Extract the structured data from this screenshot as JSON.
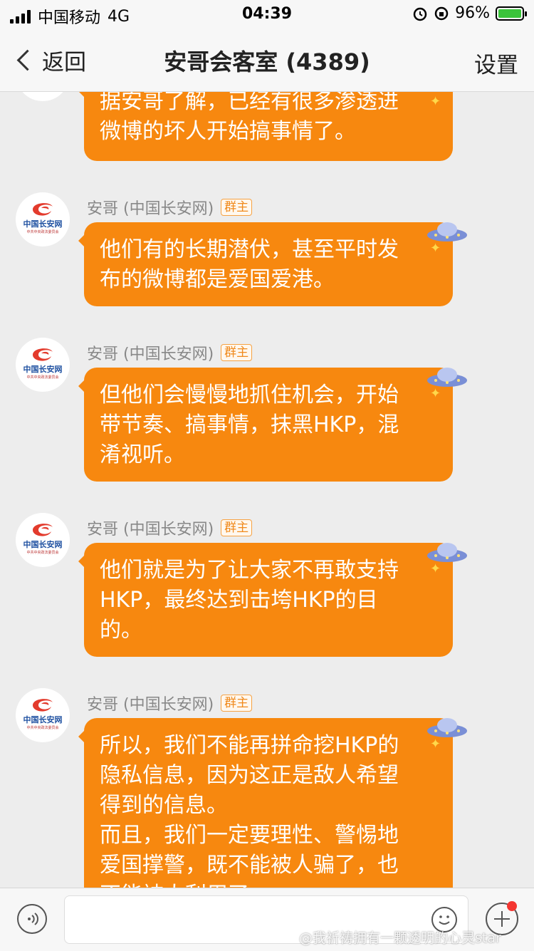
{
  "status_bar": {
    "carrier": "中国移动",
    "network": "4G",
    "time": "04:39",
    "battery": "96%",
    "battery_color": "#3ac43a"
  },
  "nav": {
    "back_label": "返回",
    "title": "安哥会客室 (4389)",
    "settings_label": "设置"
  },
  "avatar": {
    "logo_text": "中国长安网",
    "logo_sub": "中共中央政法委员会",
    "logo_color": "#e33b2d"
  },
  "messages": [
    {
      "sender": "",
      "badge": "",
      "text": "据安哥了解，已经有很多渗透进\n微博的坏人开始搞事情了。"
    },
    {
      "sender": "安哥 (中国长安网)",
      "badge": "群主",
      "text": "他们有的长期潜伏，甚至平时发\n布的微博都是爱国爱港。"
    },
    {
      "sender": "安哥 (中国长安网)",
      "badge": "群主",
      "text": "但他们会慢慢地抓住机会，开始\n带节奏、搞事情，抹黑HKP，混\n淆视听。"
    },
    {
      "sender": "安哥 (中国长安网)",
      "badge": "群主",
      "text": "他们就是为了让大家不再敢支持\nHKP，最终达到击垮HKP的目\n的。"
    },
    {
      "sender": "安哥 (中国长安网)",
      "badge": "群主",
      "text": "所以，我们不能再拼命挖HKP的\n隐私信息，因为这正是敌人希望\n得到的信息。\n而且，我们一定要理性、警惕地\n爱国撑警，既不能被人骗了，也\n不能被人利用了。"
    }
  ],
  "bubble_color": "#f7880f",
  "input_bar": {
    "placeholder": ""
  },
  "watermark": "@我祈祷拥有一颗透明的心灵star"
}
